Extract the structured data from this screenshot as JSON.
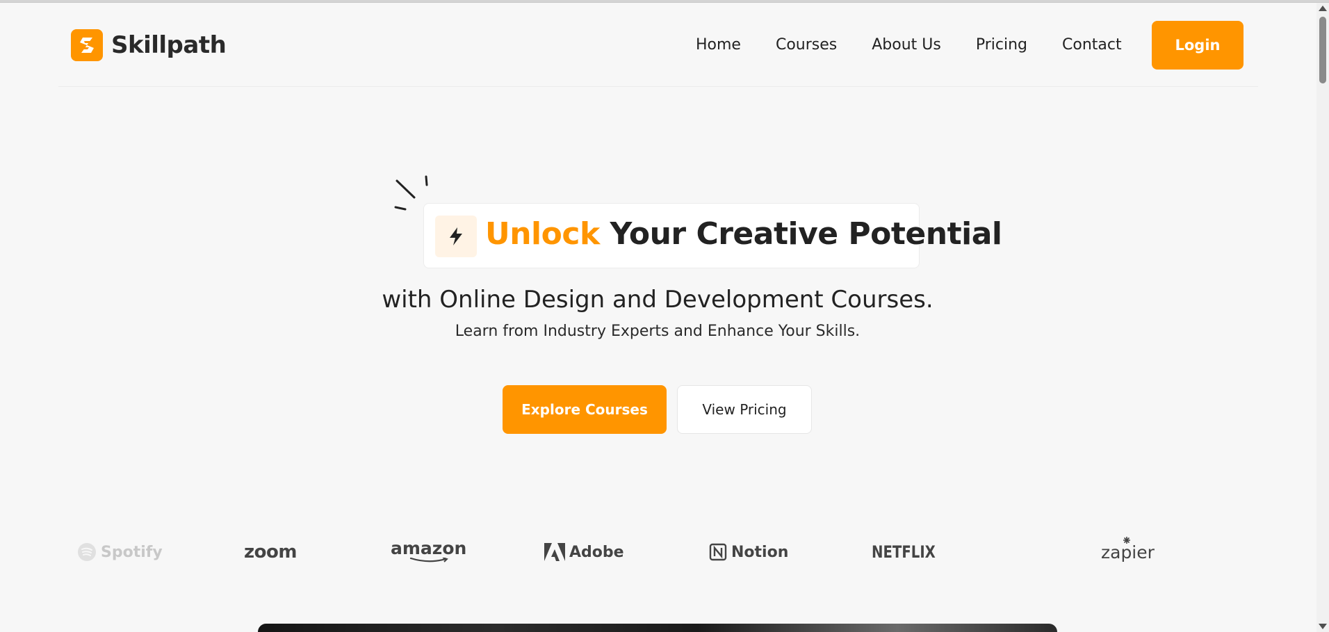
{
  "brand": {
    "name": "Skillpath",
    "accent": "#ff9500"
  },
  "nav": {
    "items": [
      {
        "label": "Home"
      },
      {
        "label": "Courses"
      },
      {
        "label": "About Us"
      },
      {
        "label": "Pricing"
      },
      {
        "label": "Contact"
      }
    ],
    "login_label": "Login"
  },
  "hero": {
    "title_accent": "Unlock",
    "title_rest": "Your Creative Potential",
    "subtitle": "with Online Design and Development Courses.",
    "tagline": "Learn from Industry Experts and Enhance Your Skills.",
    "primary_cta": "Explore Courses",
    "secondary_cta": "View Pricing"
  },
  "partners": {
    "spotify": "Spotify",
    "zoom": "zoom",
    "amazon": "amazon",
    "adobe": "Adobe",
    "notion": "Notion",
    "netflix": "NETFLIX",
    "zapier": "zapier"
  },
  "icons": {
    "logo": "skillpath-logo-icon",
    "badge": "lightning-icon",
    "decoration": "sparkle-lines-icon"
  }
}
